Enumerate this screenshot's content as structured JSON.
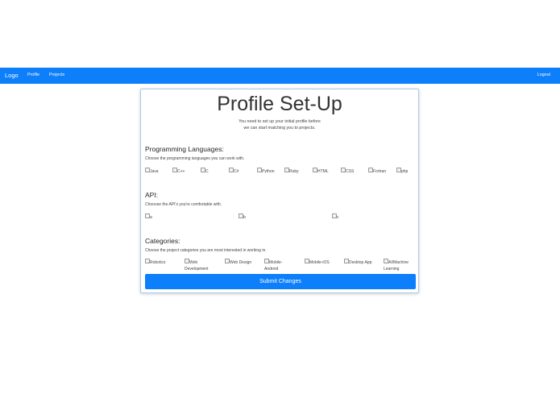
{
  "navbar": {
    "brand": "Logo",
    "links": [
      "Profile",
      "Projects"
    ],
    "logout": "Logout"
  },
  "card": {
    "title": "Profile Set-Up",
    "intro_line1": "You need to set up your initial profile before",
    "intro_line2": "we can start matching you to projects."
  },
  "languages": {
    "title": "Programming Languages:",
    "description": "Choose the programming languages you can work with.",
    "options": [
      "Java",
      "C++",
      "C",
      "C#",
      "Python",
      "Ruby",
      "HTML",
      "CSS",
      "Fortran",
      "php"
    ]
  },
  "api": {
    "title": "API:",
    "description": "Chooose the API's you're comfortable with.",
    "options": [
      "a",
      "b",
      "c"
    ]
  },
  "categories": {
    "title": "Categories:",
    "description": "Choose the project categories you are most interested in working in.",
    "options": [
      [
        "Robotics"
      ],
      [
        "Web",
        "Development"
      ],
      [
        "Web Design"
      ],
      [
        "Mobile-",
        "Android"
      ],
      [
        "Mobile-iOS"
      ],
      [
        "Desktop App"
      ],
      [
        "AI/Machine",
        "Learning"
      ]
    ]
  },
  "submit_label": "Submit Changes"
}
